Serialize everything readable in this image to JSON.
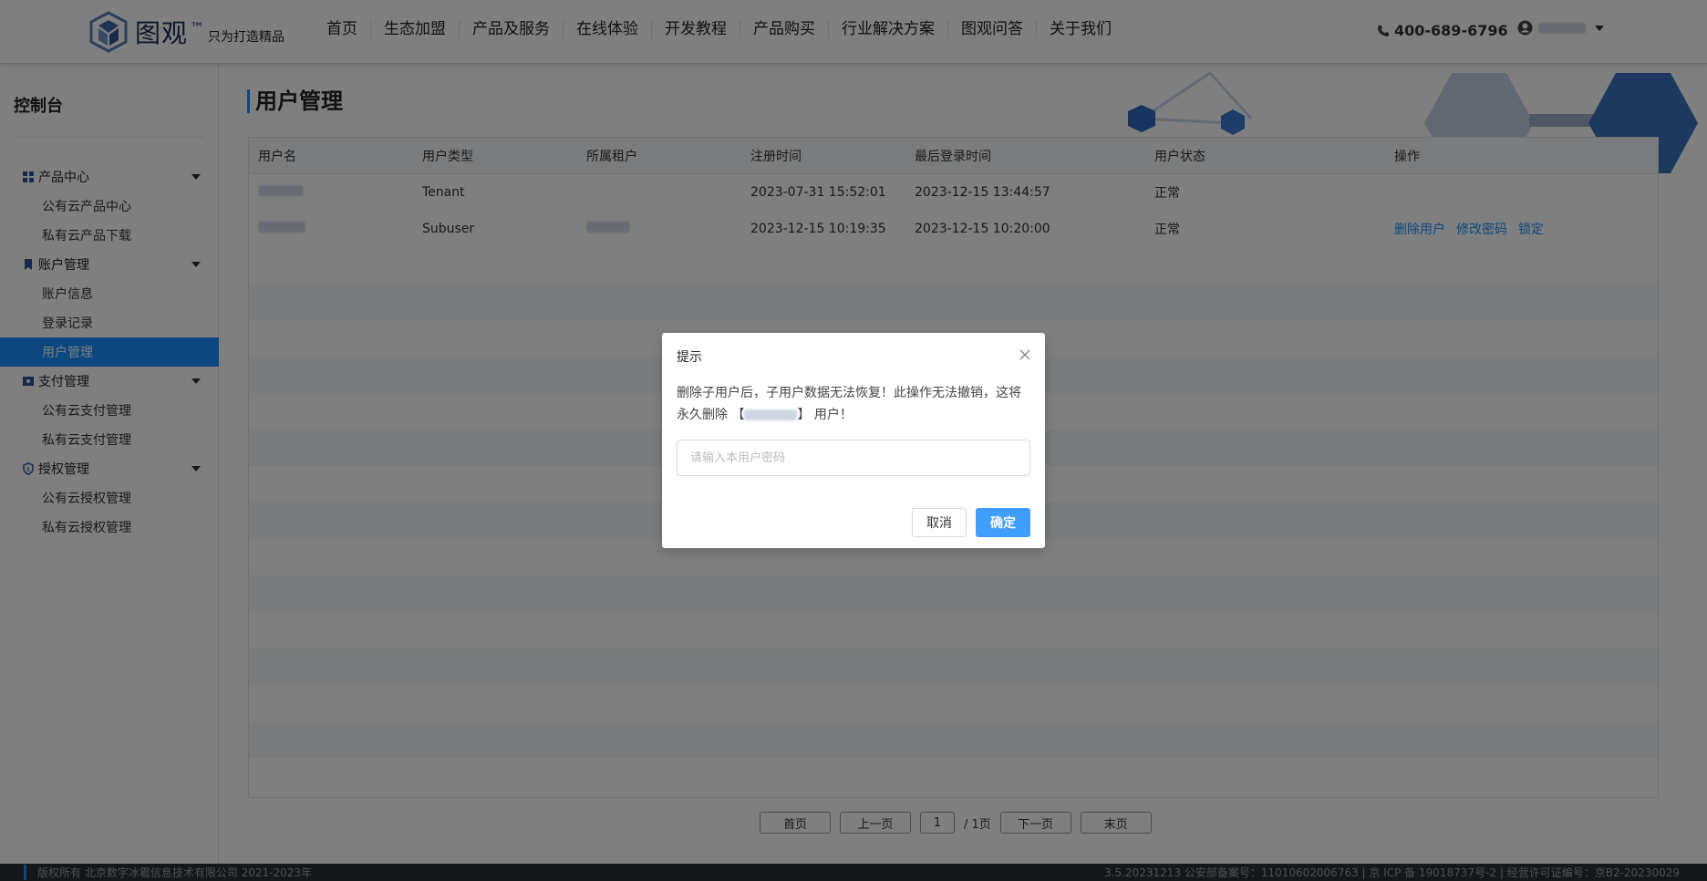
{
  "header": {
    "brand_name": "图观",
    "brand_tm": "™",
    "brand_slogan": "只为打造精品",
    "nav": [
      "首页",
      "生态加盟",
      "产品及服务",
      "在线体验",
      "开发教程",
      "产品购买",
      "行业解决方案",
      "图观问答",
      "关于我们"
    ],
    "phone": "400-689-6796"
  },
  "sidebar": {
    "title": "控制台",
    "groups": [
      {
        "label": "产品中心",
        "icon": "grid-icon",
        "items": [
          "公有云产品中心",
          "私有云产品下载"
        ]
      },
      {
        "label": "账户管理",
        "icon": "bookmark-icon",
        "items": [
          "账户信息",
          "登录记录",
          "用户管理"
        ]
      },
      {
        "label": "支付管理",
        "icon": "ticket-icon",
        "items": [
          "公有云支付管理",
          "私有云支付管理"
        ]
      },
      {
        "label": "授权管理",
        "icon": "shield-icon",
        "items": [
          "公有云授权管理",
          "私有云授权管理"
        ]
      }
    ],
    "active_item": "用户管理"
  },
  "main": {
    "title": "用户管理",
    "columns": [
      "用户名",
      "用户类型",
      "所属租户",
      "注册时间",
      "最后登录时间",
      "用户状态",
      "操作"
    ],
    "rows": [
      {
        "type": "Tenant",
        "tenant": "",
        "registered": "2023-07-31 15:52:01",
        "last_login": "2023-12-15 13:44:57",
        "status": "正常",
        "actions": []
      },
      {
        "type": "Subuser",
        "tenant": "",
        "registered": "2023-12-15 10:19:35",
        "last_login": "2023-12-15 10:20:00",
        "status": "正常",
        "actions": [
          "删除用户",
          "修改密码",
          "锁定"
        ]
      }
    ],
    "pager": {
      "first": "首页",
      "prev": "上一页",
      "page": "1",
      "total": "/ 1页",
      "next": "下一页",
      "last": "末页"
    }
  },
  "footer": {
    "left": "版权所有 北京数字冰雹信息技术有限公司 2021-2023年",
    "right": "3.5.20231213 公安部备案号：11010602006763 | 京 ICP 备 19018737号-2 | 经营许可证编号：京B2-20230029"
  },
  "dialog": {
    "title": "提示",
    "message_part1": "删除子用户后，子用户数据无法恢复！此操作无法撤销，这将永久删除 【",
    "message_part2": "】 用户！",
    "password_placeholder": "请输入本用户密码",
    "cancel": "取消",
    "confirm": "确定"
  },
  "colors": {
    "primary": "#1890ff",
    "confirm": "#409eff",
    "footer_bg": "#2b2e36"
  }
}
